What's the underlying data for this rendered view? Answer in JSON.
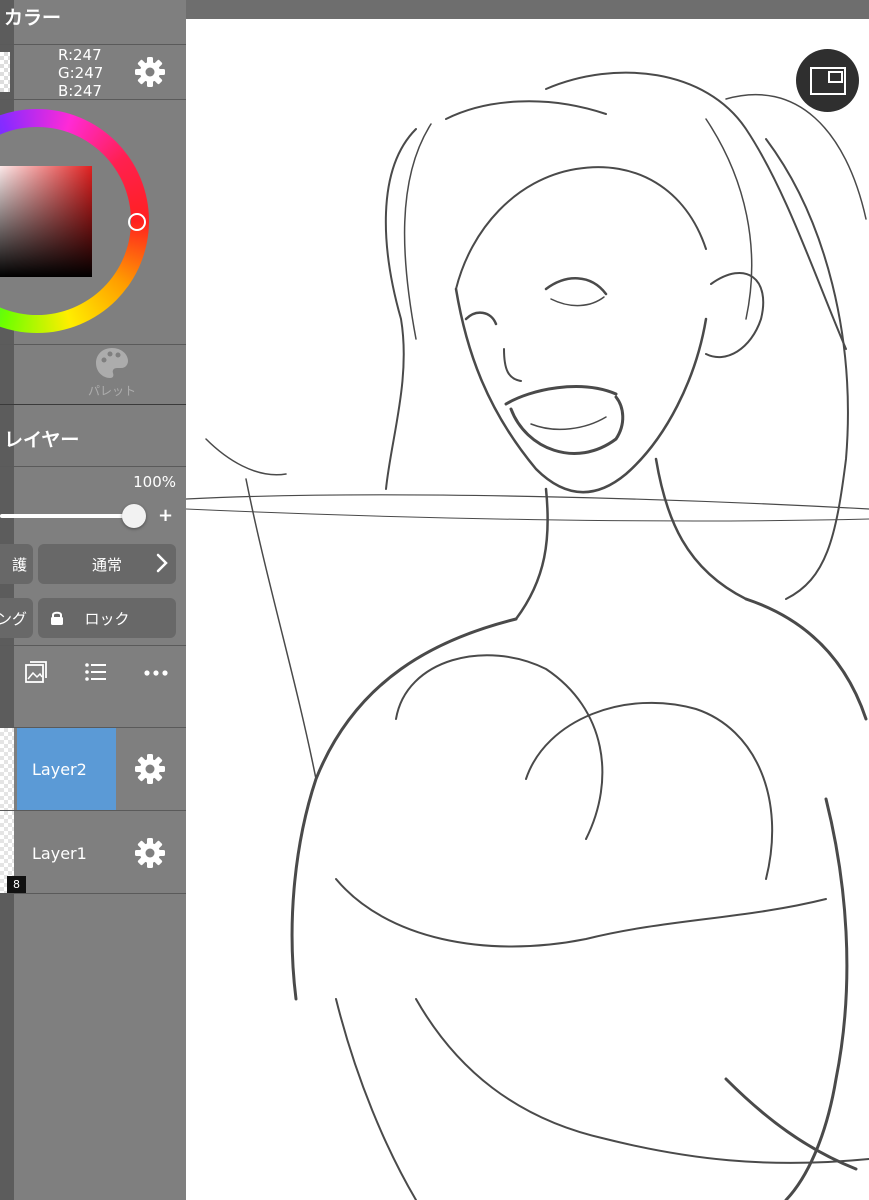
{
  "color_panel": {
    "title": "カラー",
    "rgb": {
      "r": "R:247",
      "g": "G:247",
      "b": "B:247"
    },
    "settings_icon": "gear-icon",
    "palette_icon": "palette-icon",
    "palette_label": "パレット",
    "wheel_colors": [
      "#ff2020",
      "#ff9d00",
      "#ffee00",
      "#6eff00",
      "#00c8ff",
      "#2a49ff",
      "#8a2aff",
      "#ff2ad6"
    ]
  },
  "layer_panel": {
    "title": "レイヤー",
    "opacity_label": "100%",
    "opacity": 1.0,
    "protect_label": "護",
    "blend_mode": "通常",
    "clipping_label": "ング",
    "lock_label": "ロック",
    "toolbar_icons": [
      "image-icon",
      "list-icon",
      "more-icon"
    ],
    "layers": [
      {
        "name": "Layer2",
        "selected": true,
        "color": "#5b9ad6"
      },
      {
        "name": "Layer1",
        "selected": false,
        "badge": "8"
      }
    ]
  },
  "canvas": {
    "view_toggle_icon": "window-toggle-icon",
    "background": "#ffffff"
  }
}
